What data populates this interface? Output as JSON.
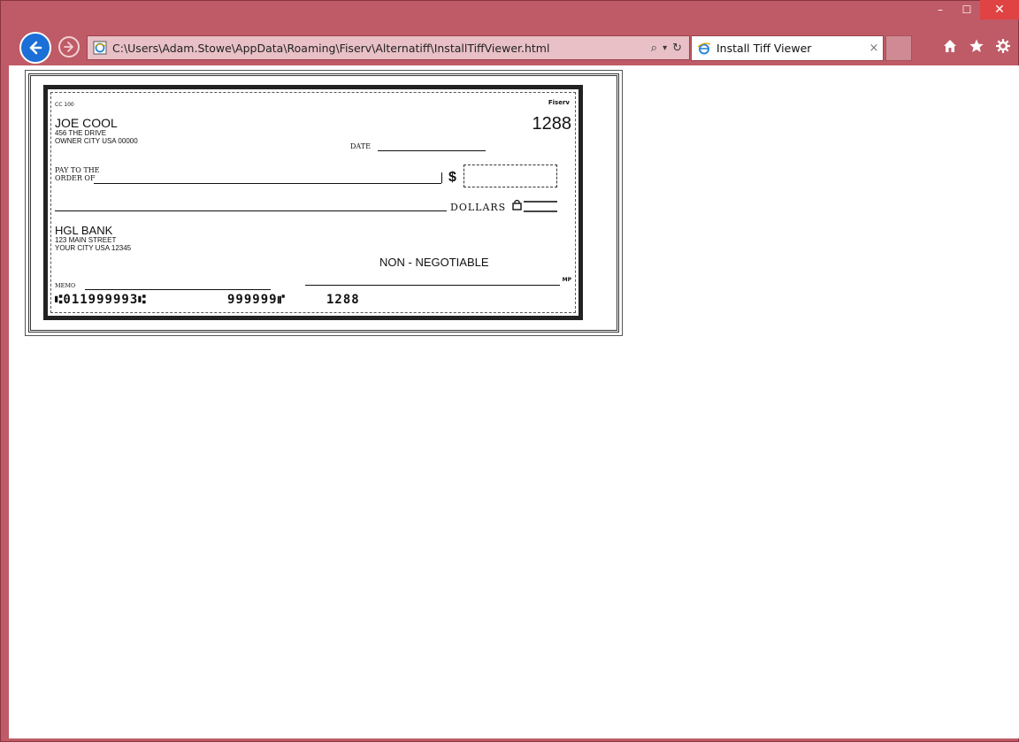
{
  "window": {
    "minimize_label": "–",
    "maximize_label": "☐",
    "close_label": "✕"
  },
  "addressbar": {
    "url": "C:\\Users\\Adam.Stowe\\AppData\\Roaming\\Fiserv\\Alternatiff\\InstallTiffViewer.html",
    "search_glyph": "⌕",
    "dropdown_glyph": "▾",
    "refresh_glyph": "↻"
  },
  "tab": {
    "title": "Install Tiff Viewer",
    "close_label": "×"
  },
  "check": {
    "form_code": "CC 100",
    "brand": "Fiserv",
    "owner_name": "JOE COOL",
    "owner_street": "456 THE DRIVE",
    "owner_city": "OWNER CITY USA 00000",
    "check_number": "1288",
    "date_label": "DATE",
    "pay_to_label_1": "PAY TO THE",
    "pay_to_label_2": "ORDER OF",
    "dollar_sign": "$",
    "dollars_label": "DOLLARS",
    "bank_name": "HGL BANK",
    "bank_street": "123 MAIN STREET",
    "bank_city": "YOUR CITY USA 12345",
    "non_negotiable": "NON - NEGOTIABLE",
    "memo_label": "MEMO",
    "mp_label": "MP",
    "micr_routing": "⑆011999993⑆",
    "micr_account": "999999⑈",
    "micr_check": "1288"
  },
  "colors": {
    "frame": "#bf5b66",
    "address_bg": "#e8c0c5",
    "back_button": "#1b6fd6",
    "close_button": "#e04343"
  }
}
